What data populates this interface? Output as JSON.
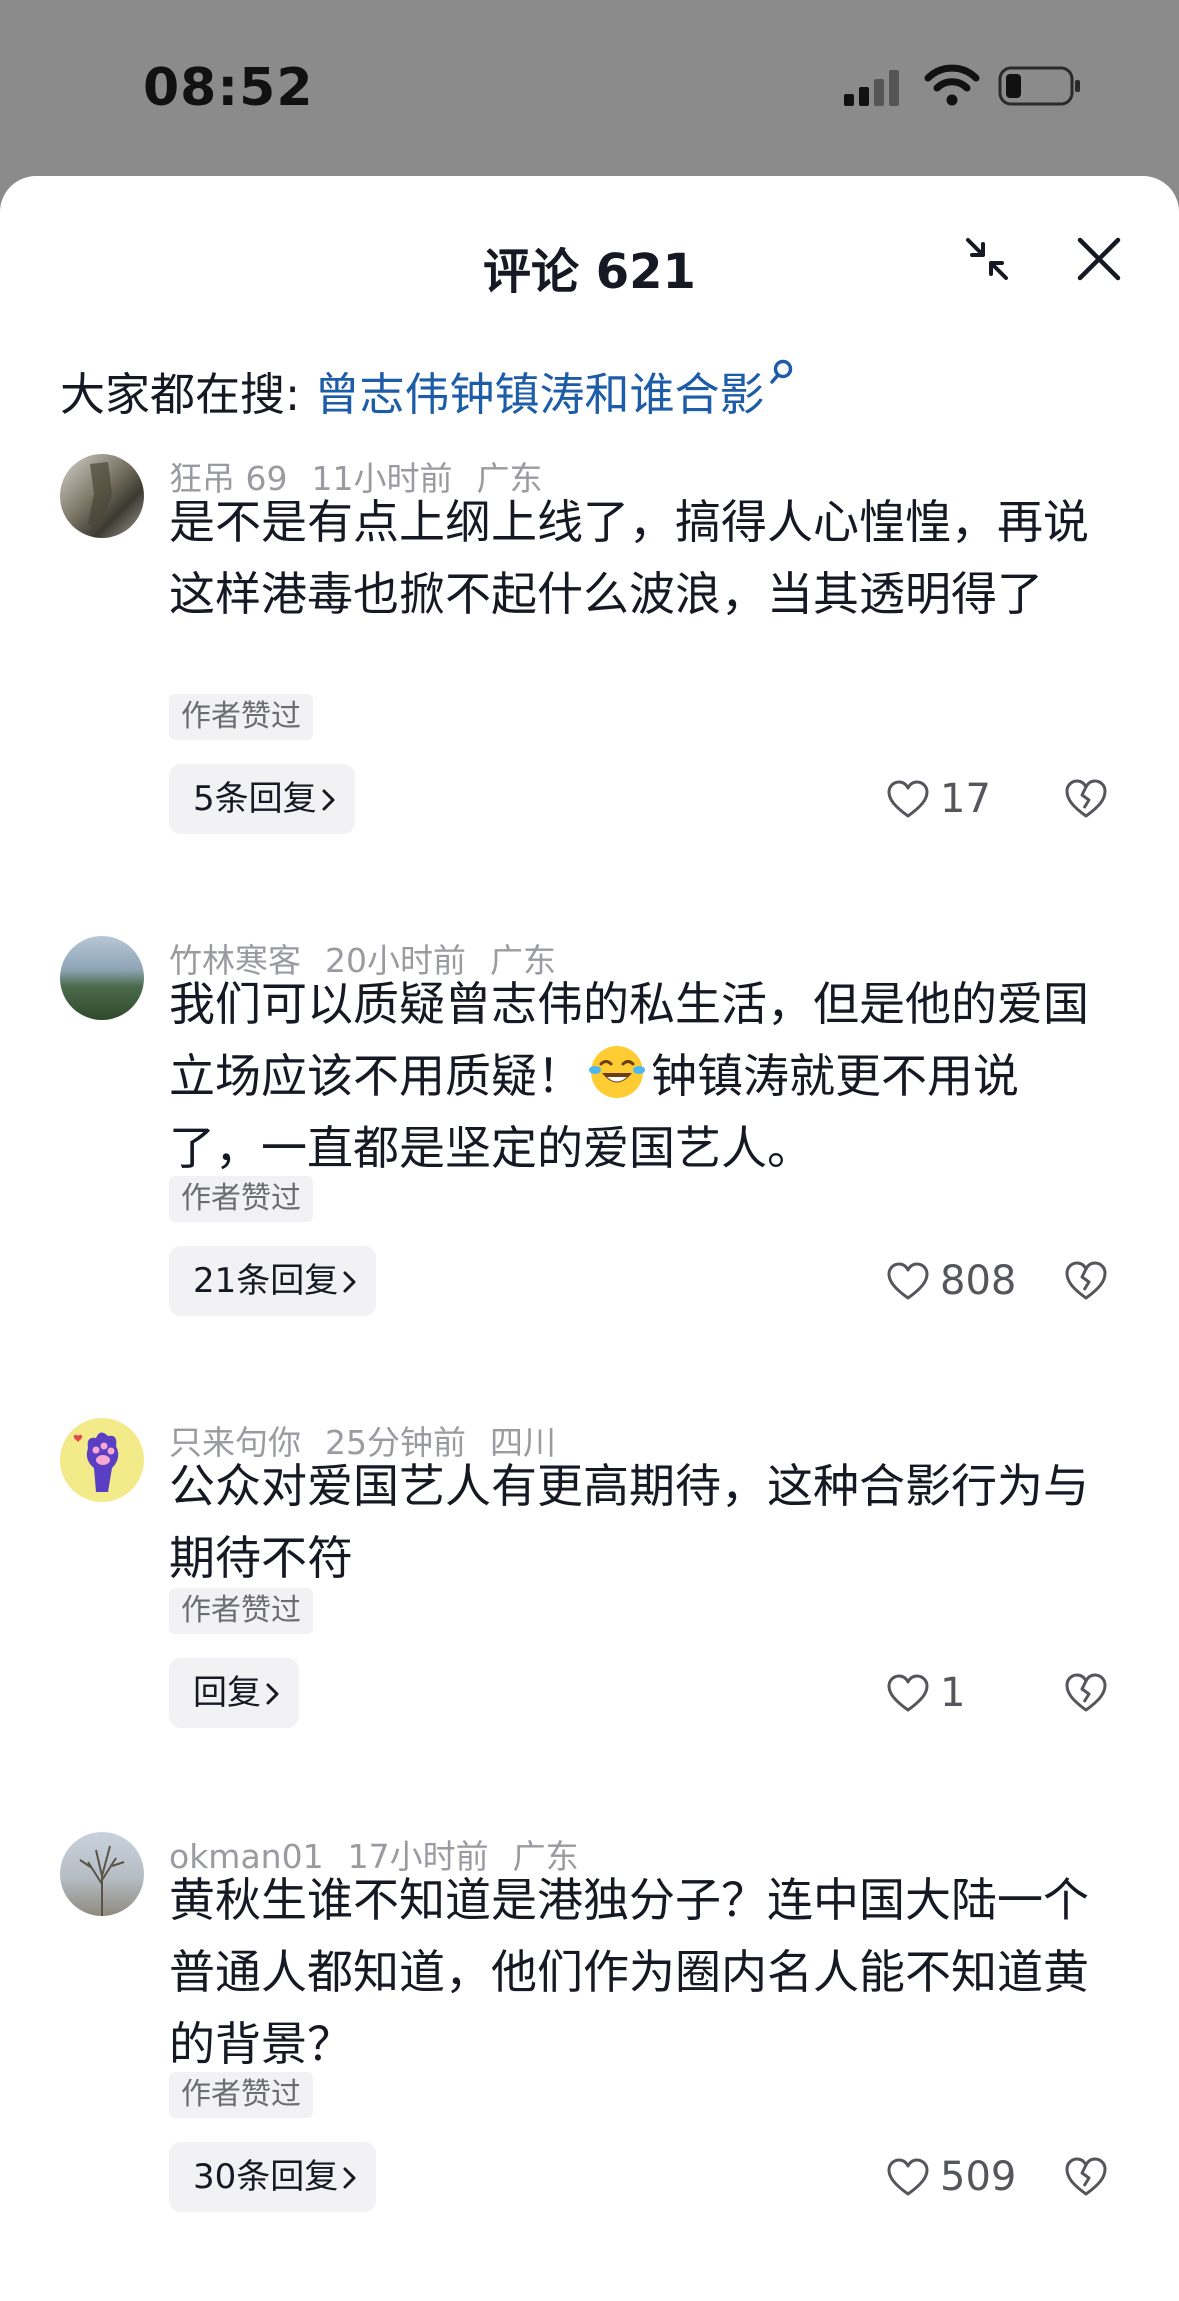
{
  "status_bar": {
    "time": "08:52"
  },
  "sheet": {
    "title": "评论 621",
    "hot_search_prefix": "大家都在搜: ",
    "hot_search_term": "曾志伟钟镇涛和谁合影"
  },
  "comments": [
    {
      "username": "狂吊 69",
      "time": "11小时前",
      "location": "广东",
      "text": "是不是有点上纲上线了，搞得人心惶惶，再说这样港毒也掀不起什么波浪，当其透明得了",
      "badge": "作者赞过",
      "reply_label": "5条回复",
      "like_count": "17"
    },
    {
      "username": "竹林寒客",
      "time": "20小时前",
      "location": "广东",
      "text_before_emoji": "我们可以质疑曾志伟的私生活，但是他的爱国立场应该不用质疑！",
      "emoji": "laughing-tears-emoji",
      "text_after_emoji": "钟镇涛就更不用说了，一直都是坚定的爱国艺人。",
      "badge": "作者赞过",
      "reply_label": "21条回复",
      "like_count": "808"
    },
    {
      "username": "只来句你",
      "time": "25分钟前",
      "location": "四川",
      "text": "公众对爱国艺人有更高期待，这种合影行为与期待不符",
      "badge": "作者赞过",
      "reply_label": "回复",
      "like_count": "1"
    },
    {
      "username": "okman01",
      "time": "17小时前",
      "location": "广东",
      "text": "黄秋生谁不知道是港独分子？连中国大陆一个普通人都知道，他们作为圈内名人能不知道黄的背景？",
      "badge": "作者赞过",
      "reply_label": "30条回复",
      "like_count": "509"
    }
  ],
  "icons": {
    "collapse": "collapse-icon",
    "close": "close-icon",
    "search": "search-icon",
    "like": "heart-icon",
    "dislike": "broken-heart-icon",
    "chevron": "chevron-right-icon"
  },
  "colors": {
    "hot_search_link": "#1d5da8",
    "meta_text": "#9a9ba0",
    "badge_bg": "#f2f2f4"
  }
}
